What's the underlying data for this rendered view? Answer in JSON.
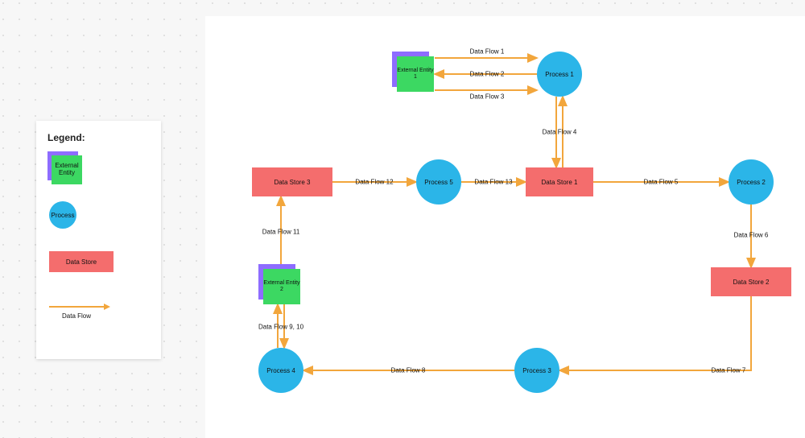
{
  "legend": {
    "title": "Legend:",
    "external_entity": "External Entity",
    "process": "Process",
    "data_store": "Data Store",
    "data_flow": "Data Flow"
  },
  "entities": {
    "e1": "External Entity 1",
    "e2": "External Entity 2"
  },
  "processes": {
    "p1": "Process 1",
    "p2": "Process 2",
    "p3": "Process 3",
    "p4": "Process 4",
    "p5": "Process 5"
  },
  "stores": {
    "s1": "Data Store 1",
    "s2": "Data Store 2",
    "s3": "Data Store 3"
  },
  "flows": {
    "f1": "Data Flow 1",
    "f2": "Data Flow 2",
    "f3": "Data Flow 3",
    "f4": "Data Flow 4",
    "f5": "Data Flow 5",
    "f6": "Data Flow 6",
    "f7": "Data Flow 7",
    "f8": "Data Flow 8",
    "f9_10": "Data Flow 9, 10",
    "f11": "Data Flow 11",
    "f12": "Data Flow 12",
    "f13": "Data Flow 13"
  },
  "colors": {
    "process": "#2bb5e8",
    "store": "#f46d6d",
    "entity_front": "#3cd862",
    "entity_back": "#8e6cff",
    "arrow": "#f2a63c"
  }
}
